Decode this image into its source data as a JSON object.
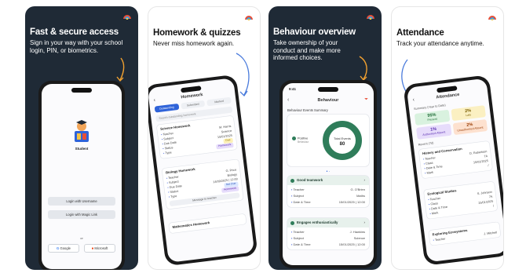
{
  "panels": [
    {
      "heading": "Fast & secure access",
      "subtitle": "Sign in your way with your school login, PIN, or biometrics.",
      "login": {
        "student_label": "Student",
        "btn_username": "Login with Username",
        "btn_magic": "Login with Magic Link",
        "or": "or",
        "btn_google": "Google",
        "btn_microsoft": "Microsoft"
      }
    },
    {
      "heading": "Homework & quizzes",
      "subtitle": "Never miss homework again.",
      "screen": {
        "title": "Homework",
        "tabs": [
          "Outstanding",
          "Submitted",
          "Marked"
        ],
        "search_placeholder": "Search outstanding homework",
        "card1": {
          "title": "Science Homework",
          "rows": [
            {
              "k": "Teacher",
              "v": "M. Harris"
            },
            {
              "k": "Subject",
              "v": "Science"
            },
            {
              "k": "Due Date",
              "v": "15/01/2025"
            },
            {
              "k": "Status",
              "v": "Due"
            },
            {
              "k": "Type",
              "v": "Homework"
            }
          ]
        },
        "card2": {
          "title": "Biology Homework",
          "rows": [
            {
              "k": "Teacher",
              "v": "G. Price"
            },
            {
              "k": "Subject",
              "v": "Biology"
            },
            {
              "k": "Due Date",
              "v": "14/09/2025 | 12:00"
            },
            {
              "k": "Status",
              "v": "Not Due"
            },
            {
              "k": "Type",
              "v": "Homework"
            }
          ],
          "message_btn": "Message to teacher"
        },
        "card3_title": "Mathematics Homework"
      }
    },
    {
      "heading": "Behaviour overview",
      "subtitle": "Take ownership of your conduct and make more informed choices.",
      "screen": {
        "time": "9:41",
        "title": "Behaviour",
        "section": "Behaviour Events Summary",
        "legend_label": "Positive",
        "legend_sub": "Behaviour",
        "donut_label": "Total Events",
        "donut_value": "80",
        "event1": {
          "title": "Good teamwork",
          "rows": [
            {
              "k": "Teacher",
              "v": "G. O'Brien"
            },
            {
              "k": "Subject",
              "v": "Maths"
            },
            {
              "k": "Date & Time",
              "v": "15/01/2025 | 12:00"
            }
          ]
        },
        "event2": {
          "title": "Engages enthusiastically",
          "rows": [
            {
              "k": "Teacher",
              "v": "J. Hawkins"
            },
            {
              "k": "Subject",
              "v": "Science"
            },
            {
              "k": "Date & Time",
              "v": "15/01/2025 | 12:00"
            }
          ]
        }
      }
    },
    {
      "heading": "Attendance",
      "subtitle": "Track your attendance anytime.",
      "screen": {
        "title": "Attendance",
        "summary_label": "Summary (Year to Date)",
        "cells": [
          {
            "value": "95%",
            "label": "Present"
          },
          {
            "value": "2%",
            "label": "Late"
          },
          {
            "value": "1%",
            "label": "Authorised Absent"
          },
          {
            "value": "2%",
            "label": "Unauthorised Absent"
          }
        ],
        "filter_label": "Recent (7d)",
        "cards": [
          {
            "title": "History and Conservation",
            "rows": [
              {
                "k": "Teacher",
                "v": "D. Robertson"
              },
              {
                "k": "Class",
                "v": "7A"
              },
              {
                "k": "Date & Time",
                "v": "15/01/2025"
              },
              {
                "k": "Mark",
                "v": "/"
              }
            ]
          },
          {
            "title": "Ecological Studies",
            "rows": [
              {
                "k": "Teacher",
                "v": "S. Johnson"
              },
              {
                "k": "Class",
                "v": "7A"
              },
              {
                "k": "Date & Time",
                "v": "15/01/2025"
              },
              {
                "k": "Mark",
                "v": "/"
              }
            ]
          },
          {
            "title": "Exploring Ecosystems",
            "rows": [
              {
                "k": "Teacher",
                "v": "J. Mitchell"
              }
            ]
          }
        ]
      }
    }
  ],
  "colors": {
    "dark_bg": "#1f2a36",
    "accent_blue": "#2f63d9",
    "positive_green": "#2f7d5a",
    "arrow_orange": "#f0a030",
    "arrow_blue": "#4a7bdc"
  }
}
